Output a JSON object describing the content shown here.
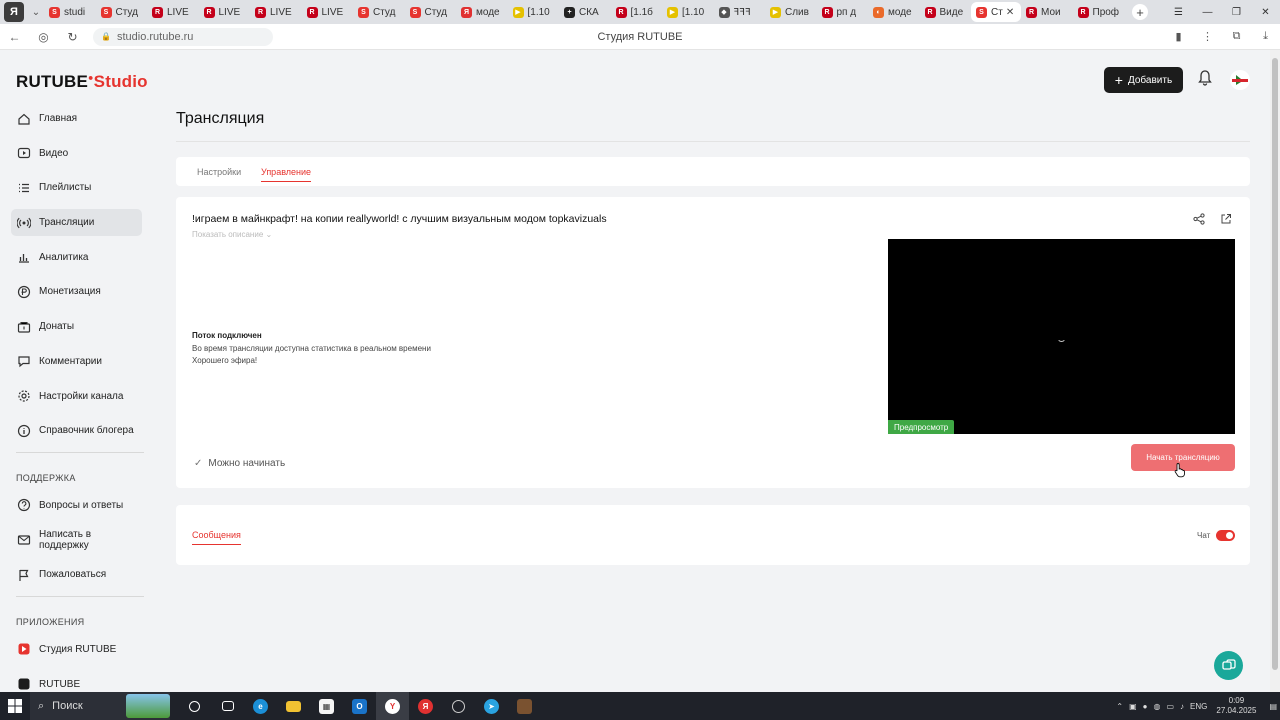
{
  "browser": {
    "tabs": [
      {
        "label": "studi",
        "fav_color": "#e6342f",
        "fav_glyph": "S"
      },
      {
        "label": "Студ",
        "fav_color": "#e6342f",
        "fav_glyph": "S"
      },
      {
        "label": "LIVE",
        "fav_color": "#c4001a",
        "fav_glyph": "R"
      },
      {
        "label": "LIVE",
        "fav_color": "#c4001a",
        "fav_glyph": "R"
      },
      {
        "label": "LIVE",
        "fav_color": "#c4001a",
        "fav_glyph": "R"
      },
      {
        "label": "LIVE",
        "fav_color": "#c4001a",
        "fav_glyph": "R"
      },
      {
        "label": "Студ",
        "fav_color": "#e6342f",
        "fav_glyph": "S"
      },
      {
        "label": "Студ",
        "fav_color": "#e6342f",
        "fav_glyph": "S"
      },
      {
        "label": "моде",
        "fav_color": "#e03131",
        "fav_glyph": "Я"
      },
      {
        "label": "[1.10",
        "fav_color": "#e5c100",
        "fav_glyph": "▶"
      },
      {
        "label": "СКА",
        "fav_color": "#222222",
        "fav_glyph": "+"
      },
      {
        "label": "[1.1б",
        "fav_color": "#c4001a",
        "fav_glyph": "R"
      },
      {
        "label": "[1.10",
        "fav_color": "#e5c100",
        "fav_glyph": "▶"
      },
      {
        "label": "ꟻꟻꟻ",
        "fav_color": "#555555",
        "fav_glyph": "◆"
      },
      {
        "label": "Слив",
        "fav_color": "#e5c100",
        "fav_glyph": "▶"
      },
      {
        "label": "рп д",
        "fav_color": "#c4001a",
        "fav_glyph": "R"
      },
      {
        "label": "моде",
        "fav_color": "#ea6a2a",
        "fav_glyph": "◐"
      },
      {
        "label": "Виде",
        "fav_color": "#c4001a",
        "fav_glyph": "R"
      },
      {
        "label": "Ст",
        "fav_color": "#e6342f",
        "fav_glyph": "S",
        "active": true
      },
      {
        "label": "Мои",
        "fav_color": "#c4001a",
        "fav_glyph": "R"
      },
      {
        "label": "Проф",
        "fav_color": "#c4001a",
        "fav_glyph": "R"
      }
    ],
    "url": "studio.rutube.ru",
    "page_title": "Студия RUTUBE"
  },
  "header": {
    "logo_main": "RUTUBE",
    "logo_studio": "Studio",
    "add_button": "Добавить"
  },
  "sidebar": {
    "items": [
      {
        "label": "Главная",
        "icon": "home-icon"
      },
      {
        "label": "Видео",
        "icon": "video-icon"
      },
      {
        "label": "Плейлисты",
        "icon": "playlist-icon"
      },
      {
        "label": "Трансляции",
        "icon": "broadcast-icon",
        "active": true
      },
      {
        "label": "Аналитика",
        "icon": "analytics-icon"
      },
      {
        "label": "Монетизация",
        "icon": "monetization-icon"
      },
      {
        "label": "Донаты",
        "icon": "donate-icon"
      },
      {
        "label": "Комментарии",
        "icon": "comments-icon"
      },
      {
        "label": "Настройки канала",
        "icon": "settings-icon"
      },
      {
        "label": "Справочник блогера",
        "icon": "info-icon"
      }
    ],
    "support_title": "ПОДДЕРЖКА",
    "support_items": [
      {
        "label": "Вопросы и ответы",
        "icon": "question-icon"
      },
      {
        "label": "Написать в поддержку",
        "icon": "mail-icon"
      },
      {
        "label": "Пожаловаться",
        "icon": "flag-icon"
      }
    ],
    "apps_title": "ПРИЛОЖЕНИЯ",
    "apps_items": [
      {
        "label": "Студия RUTUBE",
        "icon": "studio-app-icon"
      },
      {
        "label": "RUTUBE",
        "icon": "rutube-app-icon"
      }
    ]
  },
  "page": {
    "title": "Трансляция",
    "tabs": [
      "Настройки",
      "Управление"
    ],
    "active_tab": 1
  },
  "stream": {
    "title": "!играем в майнкрафт! на копии reallyworld! с лучшим визуальным модом topkavizuals",
    "show_description": "Показать описание ⌄",
    "status_title": "Поток подключен",
    "status_lines": [
      "Во время трансляции доступна статистика в реальном времени",
      "Хорошего эфира!"
    ],
    "preview_label": "Предпросмотр",
    "ready_text": "Можно начинать",
    "start_button": "Начать трансляцию"
  },
  "messages": {
    "tab": "Сообщения",
    "chat_label": "Чат",
    "chat_enabled": true
  },
  "taskbar": {
    "search_placeholder": "Поиск",
    "lang": "ENG",
    "time": "0:09",
    "date": "27.04.2025"
  },
  "colors": {
    "accent": "#e6342f",
    "start_button": "#ee6f72",
    "preview_badge": "#3fa845",
    "help_fab": "#1aa89a"
  }
}
